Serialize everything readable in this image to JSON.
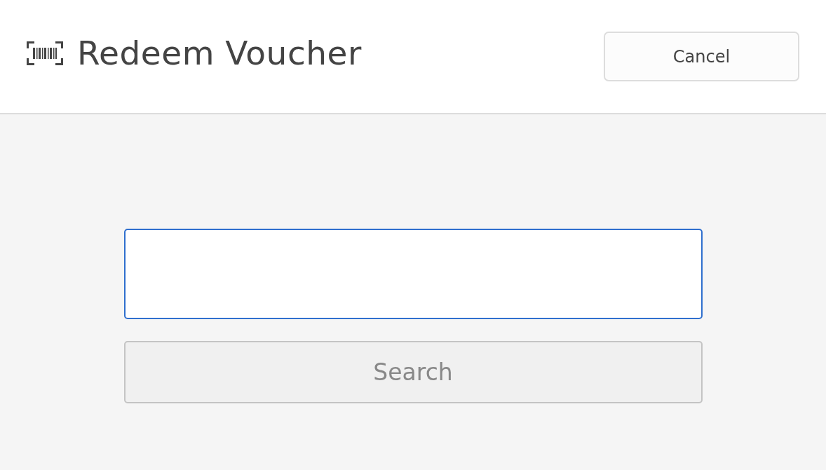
{
  "header": {
    "title": "Redeem Voucher",
    "cancel_button": "Cancel"
  },
  "voucher_field": {
    "focused": true
  },
  "search_button": {
    "label": "Search",
    "disabled": true
  }
}
